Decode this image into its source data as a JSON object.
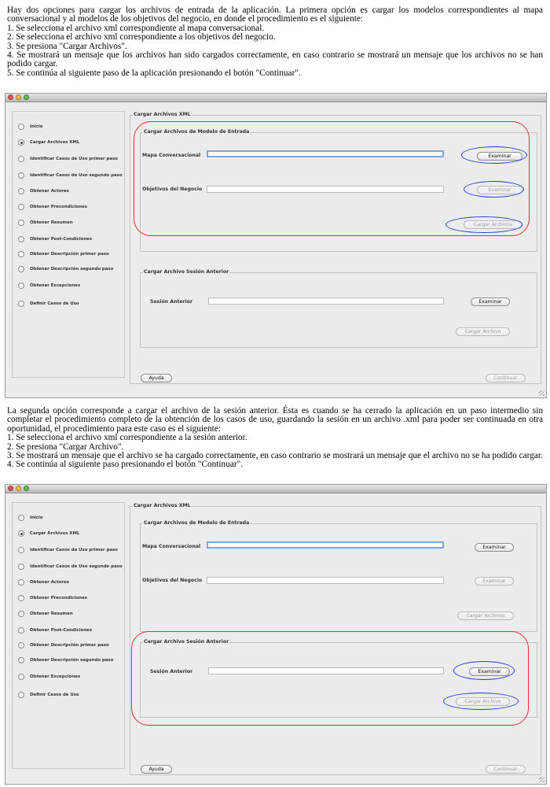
{
  "paragraph1": {
    "lines": [
      "Hay dos opciones para cargar los archivos de entrada de la aplicación. La primera opción es cargar los modelos correspondientes al mapa conversacional y al modelos de los objetivos del negocio, en donde el procedimiento es el siguiente:",
      "1. Se selecciona el archivo xml correspondiente al mapa conversacional.",
      "2. Se selecciona el archivo xml correspondiente a los objetivos del negocio.",
      "3. Se presiona \"Cargar Archivos\".",
      "4. Se mostrará un mensaje que los archivos han sido cargados correctamente, en caso contrario se mostrará un mensaje que los archivos no se han podido cargar.",
      "5. Se continúa al siguiente paso de la aplicación presionando el botón \"Continuar\"."
    ]
  },
  "paragraph2": {
    "lines": [
      "La segunda opción corresponde a cargar el archivo de la sesión anterior. Ésta es cuando se ha cerrado la aplicación en un paso intermedio sin completar el procedimiento completo de la obtención de los casos de uso, guardando la sesión en un archivo .xml para poder ser continuada en otra oportunidad, el procedimiento para este caso es el siguiente:",
      "1. Se selecciona el archivo xml correspondiente a la sesión anterior.",
      "2. Se presiona \"Cargar Archivo\".",
      "3. Se mostrará un mensaje que el archivo se ha cargado correctamente, en caso contrario se mostrará un mensaje que el archivo no se ha podido cargar.",
      "4. Se continúa al siguiente paso presionando el botón \"Continuar\"."
    ]
  },
  "app": {
    "sidebar_items": [
      "Inicio",
      "Cargar Archivos XML",
      "Identificar Casos de Uso primer paso",
      "Identificar Casos de Uso segundo paso",
      "Obtener Actores",
      "Obtener Precondiciones",
      "Obtener Resumen",
      "Obtener Post-Condiciones",
      "Obtener Descripción primer paso",
      "Obtener Descripción segundo paso",
      "Obtener Excepciones",
      "Definir Casos de Uso"
    ],
    "selected_item_index": 1,
    "outer_group_title": "Cargar Archivos XML",
    "model_group_title": "Cargar Archivos de Modelo de Entrada",
    "mapa_label": "Mapa Conversacional",
    "objetivos_label": "Objetivos del Negocio",
    "examinar_label": "Examinar",
    "cargar_archivos_label": "Cargar Archivos",
    "session_group_title": "Cargar Archivo Sesión Anterior",
    "sesion_label": "Sesión Anterior",
    "cargar_archivo_label": "Cargar Archivo",
    "ayuda_label": "Ayuda",
    "continuar_label": "Continuar"
  },
  "colors": {
    "annotation_red": "#e0312d",
    "annotation_blue": "#1f3fd6",
    "focus_border": "#7aa7de"
  }
}
